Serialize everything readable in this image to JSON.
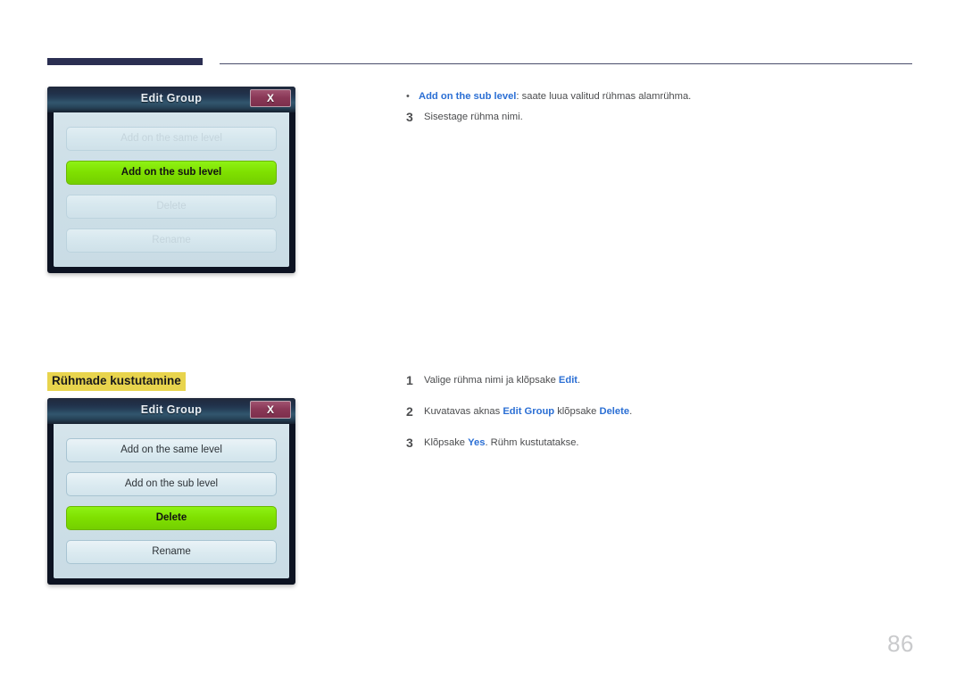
{
  "page": {
    "number": "86",
    "accent_blue": "#2b6fd4",
    "highlight_yellow": "#e8d44d",
    "rule_navy": "#2b2f52"
  },
  "section": {
    "heading": "Rühmade kustutamine"
  },
  "dialogs": [
    {
      "id": "edit-group-sub",
      "title": "Edit Group",
      "close_label": "X",
      "buttons": [
        {
          "label": "Add on the same level",
          "state": "disabled"
        },
        {
          "label": "Add on the sub level",
          "state": "selected"
        },
        {
          "label": "Delete",
          "state": "disabled"
        },
        {
          "label": "Rename",
          "state": "disabled"
        }
      ]
    },
    {
      "id": "edit-group-delete",
      "title": "Edit Group",
      "close_label": "X",
      "buttons": [
        {
          "label": "Add on the same level",
          "state": "normal"
        },
        {
          "label": "Add on the sub level",
          "state": "normal"
        },
        {
          "label": "Delete",
          "state": "selected"
        },
        {
          "label": "Rename",
          "state": "normal"
        }
      ]
    }
  ],
  "content": {
    "bullet": {
      "marker": "•",
      "keyword": "Add on the sub level",
      "rest": ": saate luua valitud rühmas alamrühma."
    },
    "step_enter_name": {
      "number": "3",
      "text": "Sisestage rühma nimi."
    },
    "steps": [
      {
        "number": "1",
        "pre": "Valige rühma nimi ja klõpsake ",
        "kw1": "Edit",
        "mid": "",
        "kw2": "",
        "post": "."
      },
      {
        "number": "2",
        "pre": "Kuvatavas aknas ",
        "kw1": "Edit Group",
        "mid": " klõpsake ",
        "kw2": "Delete",
        "post": "."
      },
      {
        "number": "3",
        "pre": "Klõpsake ",
        "kw1": "Yes",
        "mid": "",
        "kw2": "",
        "post": ". Rühm kustutatakse."
      }
    ]
  }
}
